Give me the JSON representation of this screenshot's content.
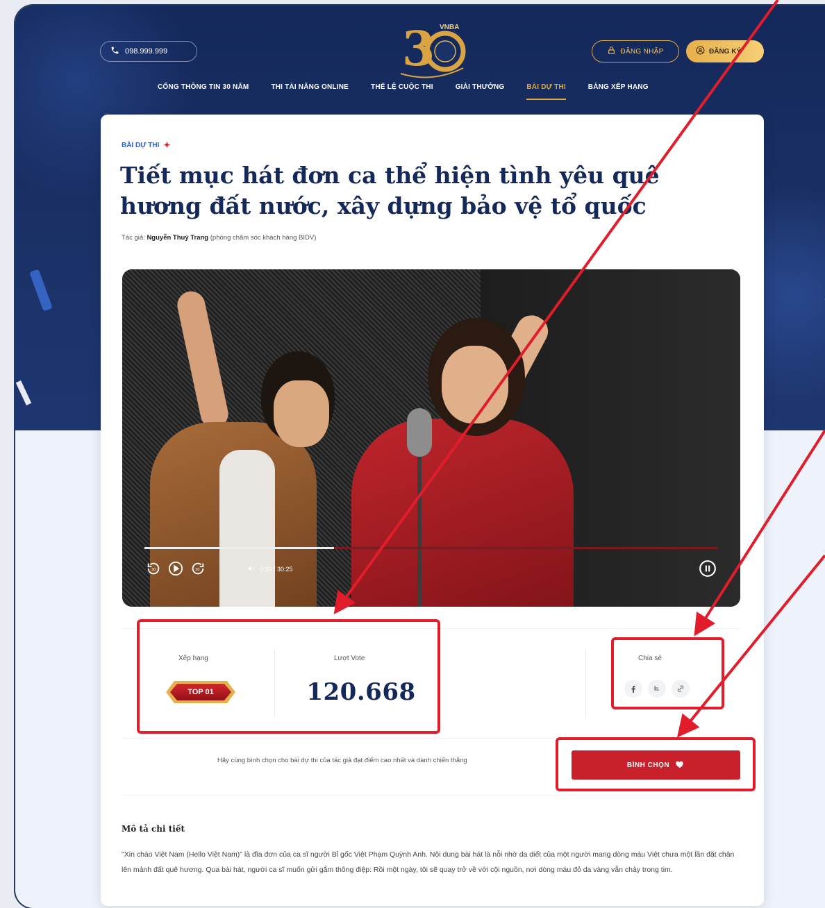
{
  "header": {
    "phone": "098.999.999",
    "logo_text": "VNBA",
    "login_label": "ĐĂNG NHẬP",
    "register_label": "ĐĂNG KÝ",
    "nav": [
      {
        "label": "CỔNG THÔNG TIN 30 NĂM",
        "active": false
      },
      {
        "label": "THI TÀI NĂNG ONLINE",
        "active": false
      },
      {
        "label": "THỂ LỆ CUỘC THI",
        "active": false
      },
      {
        "label": "GIẢI THƯỞNG",
        "active": false
      },
      {
        "label": "BÀI DỰ THI",
        "active": true
      },
      {
        "label": "BẢNG XẾP HẠNG",
        "active": false
      }
    ]
  },
  "entry": {
    "category": "BÀI DỰ THI",
    "title": "Tiết mục hát đơn ca thể hiện tình yêu quê hương đất nước, xây dựng bảo vệ tổ quốc",
    "author_prefix": "Tác giả:",
    "author_name": "Nguyễn Thuỳ Trang",
    "author_dept": "(phòng chăm sóc khách hàng BIDV)"
  },
  "video": {
    "time": "0:33 / 30:25",
    "progress_fraction": 0.33
  },
  "stats": {
    "rank_label": "Xếp hạng",
    "rank_value": "TOP 01",
    "vote_label": "Lượt Vote",
    "vote_value": "120.668",
    "share_label": "Chia sẻ"
  },
  "vote": {
    "prompt": "Hãy cùng bình chọn cho bài dự thi của tác giả đạt điểm cao nhất và dành chiến thắng",
    "button_label": "BÌNH CHỌN"
  },
  "description": {
    "title": "Mô tả chi tiết",
    "text": "\"Xin chào Việt Nam (Hello Việt Nam)\" là đĩa đơn của ca sĩ người Bỉ gốc Việt Phạm Quỳnh Anh. Nội dung bài hát là nỗi nhớ da diết của một người mang dòng máu Việt chưa một lần đặt chân lên mảnh đất quê hương. Qua bài hát, người ca sĩ muốn gửi gắm thông điệp: Rồi một ngày, tôi sẽ quay trở về với cội nguồn, nơi dòng máu đỏ da vàng vẫn chảy trong tim."
  },
  "colors": {
    "navy": "#14285a",
    "gold": "#e0a93d",
    "red": "#c9212b",
    "annotation": "#e11d2c"
  }
}
